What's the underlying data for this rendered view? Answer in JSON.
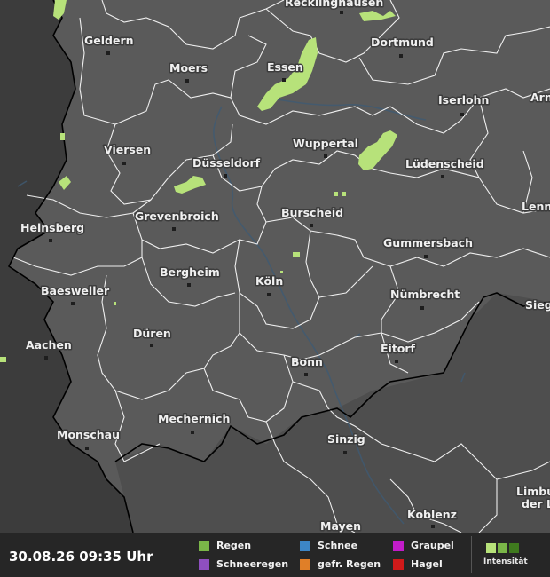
{
  "map": {
    "cities": [
      {
        "name": "Recklinghausen",
        "id": "recklinghausen"
      },
      {
        "name": "Geldern",
        "id": "geldern"
      },
      {
        "name": "Dortmund",
        "id": "dortmund"
      },
      {
        "name": "Moers",
        "id": "moers"
      },
      {
        "name": "Essen",
        "id": "essen"
      },
      {
        "name": "Iserlohn",
        "id": "iserlohn"
      },
      {
        "name": "Arn",
        "id": "arn"
      },
      {
        "name": "Viersen",
        "id": "viersen"
      },
      {
        "name": "Wuppertal",
        "id": "wuppertal"
      },
      {
        "name": "Düsseldorf",
        "id": "duesseldorf"
      },
      {
        "name": "Lüdenscheid",
        "id": "luedenscheid"
      },
      {
        "name": "Lenn",
        "id": "lenn"
      },
      {
        "name": "Grevenbroich",
        "id": "grevenbroich"
      },
      {
        "name": "Burscheid",
        "id": "burscheid"
      },
      {
        "name": "Heinsberg",
        "id": "heinsberg"
      },
      {
        "name": "Gummersbach",
        "id": "gummersbach"
      },
      {
        "name": "Bergheim",
        "id": "bergheim"
      },
      {
        "name": "Köln",
        "id": "koeln"
      },
      {
        "name": "Baesweiler",
        "id": "baesweiler"
      },
      {
        "name": "Nümbrecht",
        "id": "nuembrecht"
      },
      {
        "name": "Sieg",
        "id": "sieg"
      },
      {
        "name": "Düren",
        "id": "dueren"
      },
      {
        "name": "Aachen",
        "id": "aachen"
      },
      {
        "name": "Eitorf",
        "id": "eitorf"
      },
      {
        "name": "Bonn",
        "id": "bonn"
      },
      {
        "name": "Mechernich",
        "id": "mechernich"
      },
      {
        "name": "Monschau",
        "id": "monschau"
      },
      {
        "name": "Sinzig",
        "id": "sinzig"
      },
      {
        "name": "Limbu",
        "id": "limbu"
      },
      {
        "name": "der L",
        "id": "der-l"
      },
      {
        "name": "Koblenz",
        "id": "koblenz"
      },
      {
        "name": "Mayen",
        "id": "mayen"
      }
    ]
  },
  "legend": {
    "timestamp": "30.08.26 09:35 Uhr",
    "items": [
      {
        "label": "Regen",
        "color": "#7ab648"
      },
      {
        "label": "Schnee",
        "color": "#3d86c6"
      },
      {
        "label": "Graupel",
        "color": "#c21cc9"
      },
      {
        "label": "Schneeregen",
        "color": "#8f4fc0"
      },
      {
        "label": "gefr. Regen",
        "color": "#e07f28"
      },
      {
        "label": "Hagel",
        "color": "#d01a1a"
      }
    ],
    "intensity_label": "Intensität",
    "intensity_colors": [
      "#b7e27a",
      "#7ab648",
      "#3f7a1e"
    ]
  }
}
